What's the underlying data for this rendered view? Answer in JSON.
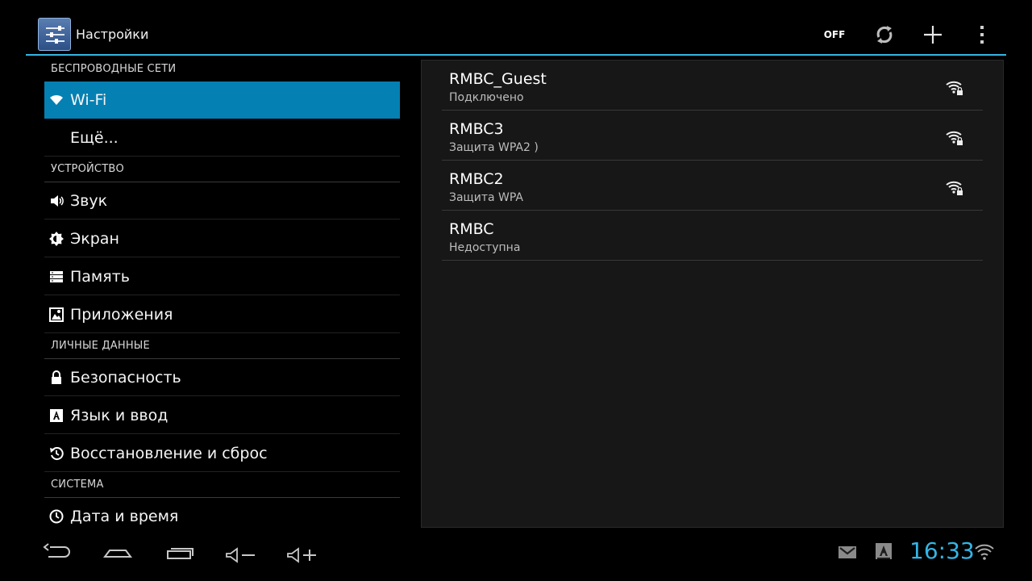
{
  "actionbar": {
    "title": "Настройки",
    "app_icon": "settings-sliders-icon",
    "wifi_toggle_label": "OFF",
    "actions": [
      "wps-icon",
      "add-icon",
      "overflow-menu-icon"
    ]
  },
  "sidebar": {
    "sections": [
      {
        "header": "БЕСПРОВОДНЫЕ СЕТИ",
        "items": [
          {
            "label": "Wi-Fi",
            "icon": "wifi-icon",
            "selected": true
          },
          {
            "label": "Ещё...",
            "icon": ""
          }
        ]
      },
      {
        "header": "УСТРОЙСТВО",
        "items": [
          {
            "label": "Звук",
            "icon": "speaker-icon"
          },
          {
            "label": "Экран",
            "icon": "brightness-icon"
          },
          {
            "label": "Память",
            "icon": "storage-icon"
          },
          {
            "label": "Приложения",
            "icon": "apps-icon"
          }
        ]
      },
      {
        "header": "ЛИЧНЫЕ ДАННЫЕ",
        "items": [
          {
            "label": "Безопасность",
            "icon": "lock-icon"
          },
          {
            "label": "Язык и ввод",
            "icon": "keyboard-icon"
          },
          {
            "label": "Восстановление и сброс",
            "icon": "restore-icon"
          }
        ]
      },
      {
        "header": "СИСТЕМА",
        "items": [
          {
            "label": "Дата и время",
            "icon": "clock-icon"
          }
        ]
      }
    ]
  },
  "networks": [
    {
      "ssid": "RMBC_Guest",
      "status": "Подключено",
      "secured_signal": true
    },
    {
      "ssid": "RMBC3",
      "status": "Защита WPA2 )",
      "secured_signal": true
    },
    {
      "ssid": "RMBC2",
      "status": "Защита WPA",
      "secured_signal": true
    },
    {
      "ssid": "RMBC",
      "status": "Недоступна",
      "secured_signal": false
    }
  ],
  "navbar": {
    "buttons": [
      "back-icon",
      "home-icon",
      "recent-apps-icon",
      "volume-down-icon",
      "volume-up-icon"
    ],
    "tray": [
      "gmail-icon",
      "keyboard-notification-icon",
      "wifi-status-icon"
    ],
    "clock": "16:33"
  },
  "colors": {
    "accent": "#33b5e5",
    "selected_row": "#0480b3",
    "panel_bg": "#171717"
  }
}
